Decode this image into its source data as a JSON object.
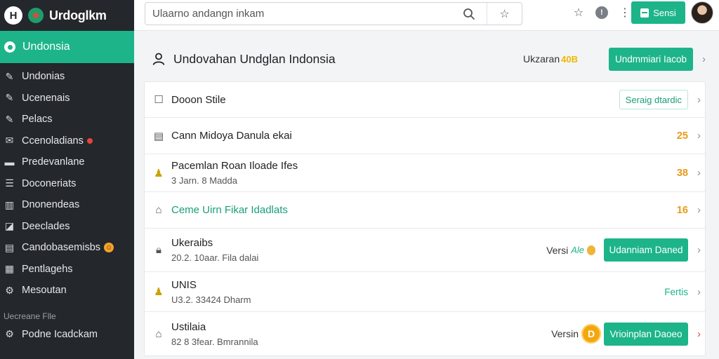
{
  "brand": {
    "logo": "H",
    "name": "Urdoglkm"
  },
  "sidebar": {
    "active": {
      "label": "Undonsia",
      "icon": "circle-icon"
    },
    "items": [
      {
        "label": "Undonias",
        "icon": "pin-icon"
      },
      {
        "label": "Ucenenais",
        "icon": "pin-icon"
      },
      {
        "label": "Pelacs",
        "icon": "pin-icon"
      },
      {
        "label": "Ccenoladians",
        "icon": "mail-icon",
        "badge": "dot"
      },
      {
        "label": "Predevanlane",
        "icon": "folder-icon"
      },
      {
        "label": "Doconeriats",
        "icon": "list-icon"
      },
      {
        "label": "Dnonendeas",
        "icon": "columns-icon"
      },
      {
        "label": "Deeclades",
        "icon": "chart-icon"
      },
      {
        "label": "Candobasemisbs",
        "icon": "window-icon",
        "badge": "emoji"
      },
      {
        "label": "Pentlagehs",
        "icon": "grid-icon"
      },
      {
        "label": "Mesoutan",
        "icon": "gear-icon"
      }
    ],
    "section_label": "Uecreane Flle",
    "section_items": [
      {
        "label": "Podne Icadckam",
        "icon": "gear-icon"
      }
    ]
  },
  "topbar": {
    "search_placeholder": "Ulaarno andangn inkam",
    "search_icon": "search-icon",
    "bookmark_icon": "star-icon",
    "star_icon": "star-icon",
    "info_icon": "!",
    "more_icon": "⋮",
    "button_label": "Sensi"
  },
  "header": {
    "title": "Undovahan Undglan Indonsia",
    "label": "Ukzaran",
    "count": "40B",
    "button_label": "Undmmiari Iacob"
  },
  "rows": [
    {
      "icon": "checkbox-icon",
      "title": "Dooon Stile",
      "subtitle": "",
      "right_type": "outline",
      "right_label": "Seraig dtardic"
    },
    {
      "icon": "document-icon",
      "title": "Cann Midoya Danula ekai",
      "subtitle": "",
      "right_type": "num",
      "right_label": "25"
    },
    {
      "icon": "bulb-icon",
      "title": "Pacemlan Roan Iloade Ifes",
      "subtitle": "3 Jarn. 8 Madda",
      "right_type": "num",
      "right_label": "38"
    },
    {
      "icon": "home-icon",
      "title": "Ceme Uirn Fikar Idadlats",
      "subtitle": "",
      "right_type": "num",
      "right_label": "16",
      "teal": true
    },
    {
      "icon": "lock-icon",
      "title": "Ukeraibs",
      "subtitle": "20.2. 10aar. Fila dalai",
      "right_type": "version-small",
      "version_label": "Versi",
      "version_tag": "Ale",
      "right_label": "Udanniam Daned"
    },
    {
      "icon": "bulb-icon",
      "title": "UNIS",
      "subtitle": "U3.2. 33424 Dharm",
      "right_type": "green-text",
      "right_label": "Fertis"
    },
    {
      "icon": "home-icon",
      "title": "Ustilaia",
      "subtitle": "82 8 3fear. Bmrannila",
      "right_type": "version-large",
      "version_label": "Versin",
      "coin_label": "D",
      "right_label": "Vrioinplan Daoeo"
    }
  ],
  "colors": {
    "accent": "#1db489",
    "sidebar": "#24272b",
    "warning": "#e89a1a"
  }
}
